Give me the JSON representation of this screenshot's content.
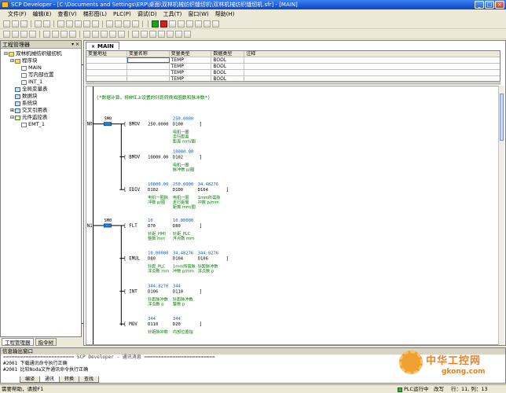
{
  "window": {
    "title": "SCP Developer - [C:\\Documents and Settings\\ERP\\桌面\\双林机械纺织缝纫机\\双林机械纺织缝纫机.sfr] - [MAIN]",
    "min": "_",
    "max": "□",
    "close": "×"
  },
  "menu": [
    "文件(F)",
    "编辑(E)",
    "查看(V)",
    "梯形图(L)",
    "PLC(P)",
    "调试(D)",
    "工具(T)",
    "窗口(W)",
    "帮助(H)"
  ],
  "project_manager": {
    "title": "工程管理器",
    "controls": "▾ ×",
    "tree": [
      {
        "label": "双林机械纺织缝纫机",
        "level": 0,
        "icon": "folder",
        "twist": "⊟"
      },
      {
        "label": "程序块",
        "level": 1,
        "icon": "folder",
        "twist": "⊟"
      },
      {
        "label": "MAIN",
        "level": 2,
        "icon": "doc",
        "twist": ""
      },
      {
        "label": "写内部位置",
        "level": 2,
        "icon": "doc",
        "twist": ""
      },
      {
        "label": "INT_1",
        "level": 2,
        "icon": "doc",
        "twist": ""
      },
      {
        "label": "全局变量表",
        "level": 1,
        "icon": "grid",
        "twist": ""
      },
      {
        "label": "数据块",
        "level": 1,
        "icon": "grid",
        "twist": ""
      },
      {
        "label": "系统块",
        "level": 1,
        "icon": "grid",
        "twist": ""
      },
      {
        "label": "交叉引用表",
        "level": 1,
        "icon": "grid",
        "twist": "⊞"
      },
      {
        "label": "元件监控表",
        "level": 1,
        "icon": "mon",
        "twist": "⊟"
      },
      {
        "label": "EMT_1",
        "level": 2,
        "icon": "doc",
        "twist": ""
      }
    ],
    "tabs": [
      "工程管理器",
      "指令树"
    ]
  },
  "editor": {
    "tab_label": "MAIN",
    "tab_close": "×",
    "var_table": {
      "headers": [
        "变量地址",
        "变量名称",
        "变量类型",
        "数据类型",
        "注释"
      ],
      "rows": [
        [
          "",
          "",
          "TEMP",
          "BOOL",
          ""
        ],
        [
          "",
          "",
          "TEMP",
          "BOOL",
          ""
        ],
        [
          "",
          "",
          "TEMP",
          "BOOL",
          ""
        ],
        [
          "",
          "",
          "TEMP",
          "BOOL",
          ""
        ]
      ]
    },
    "ladder": {
      "comment": "(*数据计算，将HMI上设置的针距转换成圈数和脉冲数*)",
      "network_labels": [
        "N0",
        "N1"
      ],
      "contact_label": "SM0",
      "instructions": [
        {
          "id": "i0",
          "mnemonic": "BMOV",
          "op1": "250.0000",
          "op2": "D100",
          "op3": "",
          "mon1": "",
          "mon2": "250.0000",
          "mon3": "",
          "c1": "",
          "c2": "电机一圈|走行距离|距离 mm/圈",
          "c3": ""
        },
        {
          "id": "i1",
          "mnemonic": "BMOV",
          "op1": "10000.00",
          "op2": "D102",
          "op3": "",
          "mon1": "",
          "mon2": "10000.00",
          "mon3": "",
          "c1": "",
          "c2": "电机一圈|脉冲数 p/圈",
          "c3": ""
        },
        {
          "id": "i2",
          "mnemonic": "EDIV",
          "op1": "D102",
          "op2": "D100",
          "op3": "D104",
          "mon1": "10000.00",
          "mon2": "250.0000",
          "mon3": "34.48276",
          "c1": "电机一圈脉|冲数 p/圈",
          "c2": "电机一圈|走行距离|距离 mm/圈",
          "c3": "1mm所需脉|冲数 p/mm"
        },
        {
          "id": "i3",
          "mnemonic": "FLT",
          "op1": "D70",
          "op2": "D80",
          "op3": "",
          "mon1": "10",
          "mon2": "10.00000",
          "mon3": "",
          "c1": "针距_HMI|整数 mm",
          "c2": "针距_PLC|浮点数 mm",
          "c3": ""
        },
        {
          "id": "i4",
          "mnemonic": "EMUL",
          "op1": "D80",
          "op2": "D104",
          "op3": "D106",
          "mon1": "10.00000",
          "mon2": "34.48276",
          "mon3": "344.8276",
          "c1": "针距_PLC|浮点数 mm",
          "c2": "1mm所需脉|冲数 p/mm",
          "c3": "针距脉冲数|浮点数 p"
        },
        {
          "id": "i5",
          "mnemonic": "INT",
          "op1": "D106",
          "op2": "D110",
          "op3": "",
          "mon1": "344.8276",
          "mon2": "344",
          "mon3": "",
          "c1": "针距脉冲数|浮点数 p",
          "c2": "针距脉冲数|整数 p",
          "c3": ""
        },
        {
          "id": "i6",
          "mnemonic": "MOV",
          "op1": "D110",
          "op2": "D20",
          "op3": "",
          "mon1": "344",
          "mon2": "344",
          "mon3": "",
          "c1": "针距脉冲数",
          "c2": "内部位置指",
          "c3": ""
        }
      ]
    }
  },
  "output": {
    "title": "信息输出窗口",
    "lines": [
      "========================= SCP Developer - 通讯消息 =========================",
      "#2001  下载通讯命令执行正确",
      "#2001  比较Noda文件通讯命令执行正确"
    ],
    "tabs": [
      "编译",
      "通讯",
      "转换",
      "查找"
    ]
  },
  "status": {
    "help": "需要帮助，请按F1",
    "plc": "PLC运行中",
    "mode": "改写",
    "position": "行：11, 列：13"
  },
  "watermark": {
    "text1": "中华工控网",
    "text2": "gkong.com"
  },
  "colors": {
    "title_blue": "#1c5bd8",
    "comment_green": "#008000",
    "monitor_blue": "#0060e0",
    "contact_blue": "#0050a0"
  }
}
